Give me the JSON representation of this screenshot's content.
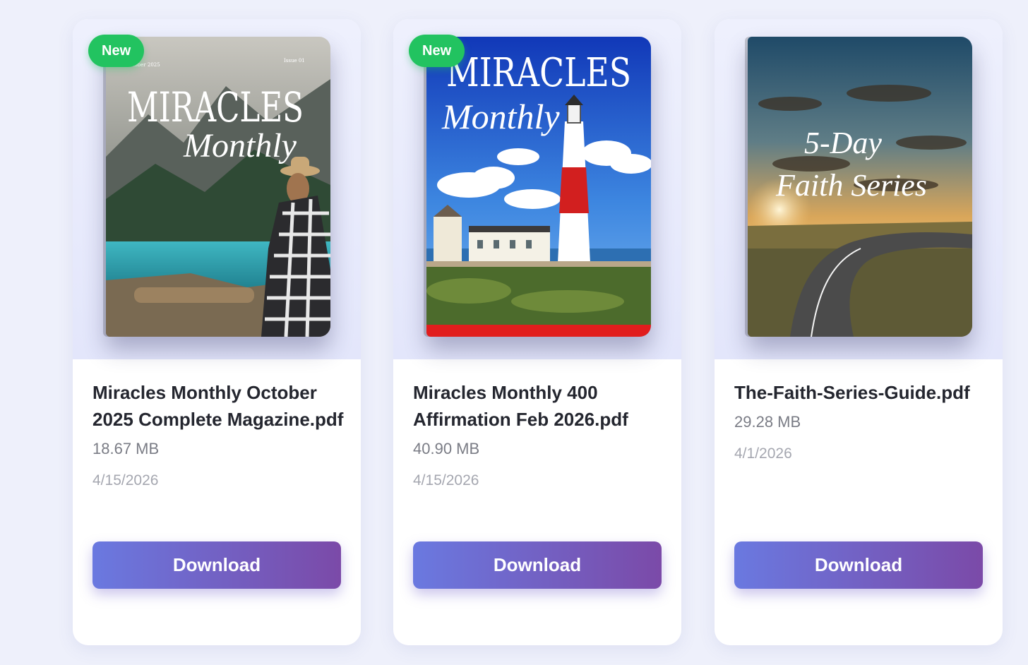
{
  "badge_label": "New",
  "download_label": "Download",
  "files": [
    {
      "title": "Miracles Monthly October 2025 Complete Magazine.pdf",
      "size": "18.67 MB",
      "date": "4/15/2026",
      "is_new": true,
      "cover": {
        "title": "MIRACLES",
        "subtitle": "Monthly",
        "issue_date": "October 2025",
        "issue": "Issue 01"
      }
    },
    {
      "title": "Miracles Monthly 400 Affirmation Feb 2026.pdf",
      "size": "40.90 MB",
      "date": "4/15/2026",
      "is_new": true,
      "cover": {
        "title": "MIRACLES",
        "subtitle": "Monthly"
      }
    },
    {
      "title": "The-Faith-Series-Guide.pdf",
      "size": "29.28 MB",
      "date": "4/1/2026",
      "is_new": false,
      "cover": {
        "title": "5-Day",
        "subtitle": "Faith Series"
      }
    }
  ],
  "colors": {
    "page_bg": "#eef0fb",
    "badge": "#22c360",
    "button_gradient_start": "#6a79e0",
    "button_gradient_end": "#7b4aa8"
  }
}
